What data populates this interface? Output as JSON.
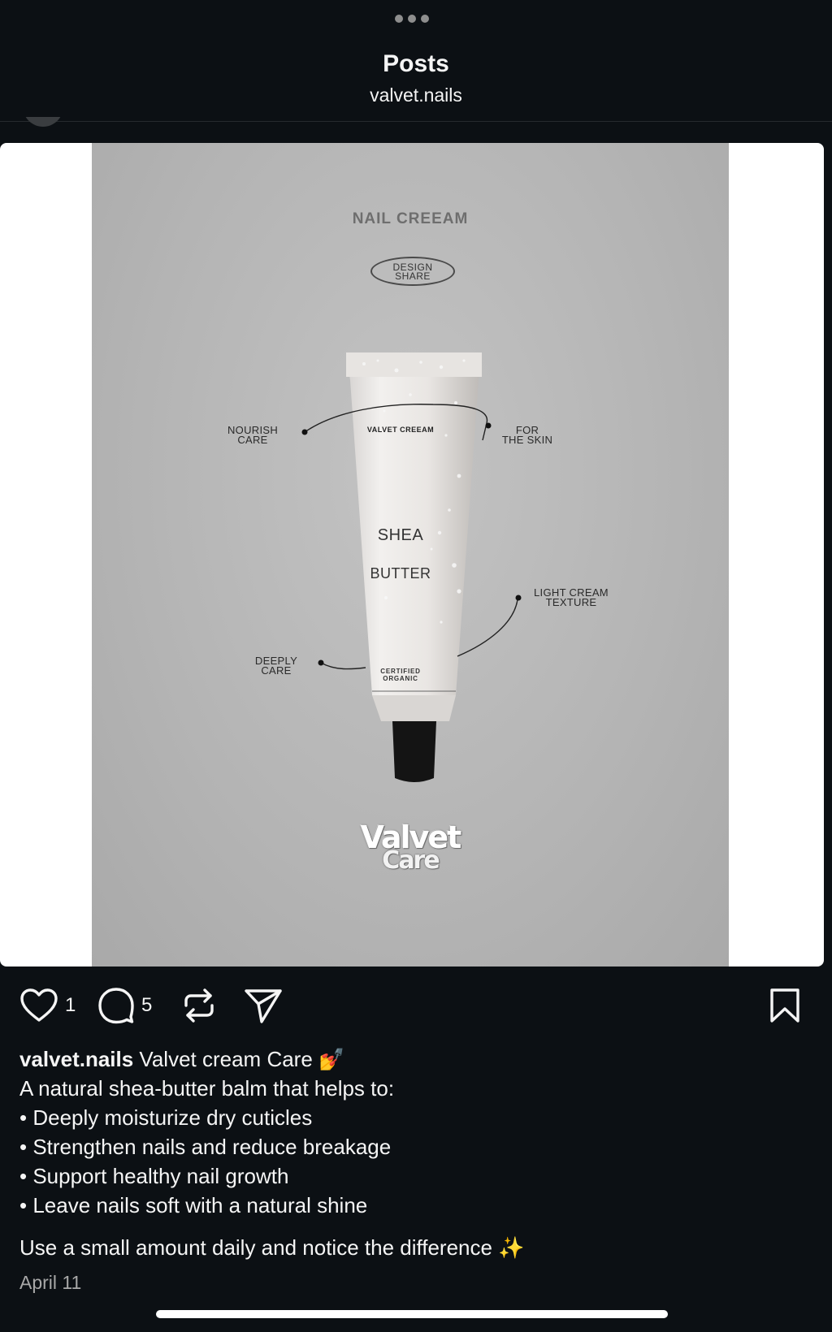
{
  "header": {
    "title": "Posts",
    "subtitle": "valvet.nails"
  },
  "poster": {
    "title": "NAIL CREEAM",
    "badge": "DESIGN\nSHARE",
    "labels": {
      "nourish": "NOURISH\nCARE",
      "skin": "FOR\nTHE SKIN",
      "texture": "LIGHT CREAM\nTEXTURE",
      "deeply": "DEEPLY\nCARE"
    },
    "tube": {
      "brand": "VALVET CREEAM",
      "shea": "SHEA",
      "butter": "BUTTER",
      "certified": "CERTIFIED\nORGANIC"
    },
    "logo": {
      "line1": "Valvet",
      "line2": "Care"
    }
  },
  "actions": {
    "like_count": "1",
    "comment_count": "5",
    "icons": [
      "heart-icon",
      "comment-icon",
      "repost-icon",
      "share-icon",
      "bookmark-icon"
    ]
  },
  "caption": {
    "username": "valvet.nails",
    "headline": " Valvet cream Care 💅",
    "intro": "A natural shea-butter balm that helps to:",
    "bullets": [
      "• Deeply moisturize dry cuticles",
      "• Strengthen nails and reduce breakage",
      "• Support healthy nail growth",
      "• Leave nails soft with a natural shine"
    ],
    "outro": "Use a small amount daily and notice the difference ✨"
  },
  "date": "April 11",
  "colors": {
    "background": "#0c1014",
    "text": "#f5f5f5",
    "muted": "#a8a8a8",
    "poster_gray": "#b4b4b4"
  }
}
